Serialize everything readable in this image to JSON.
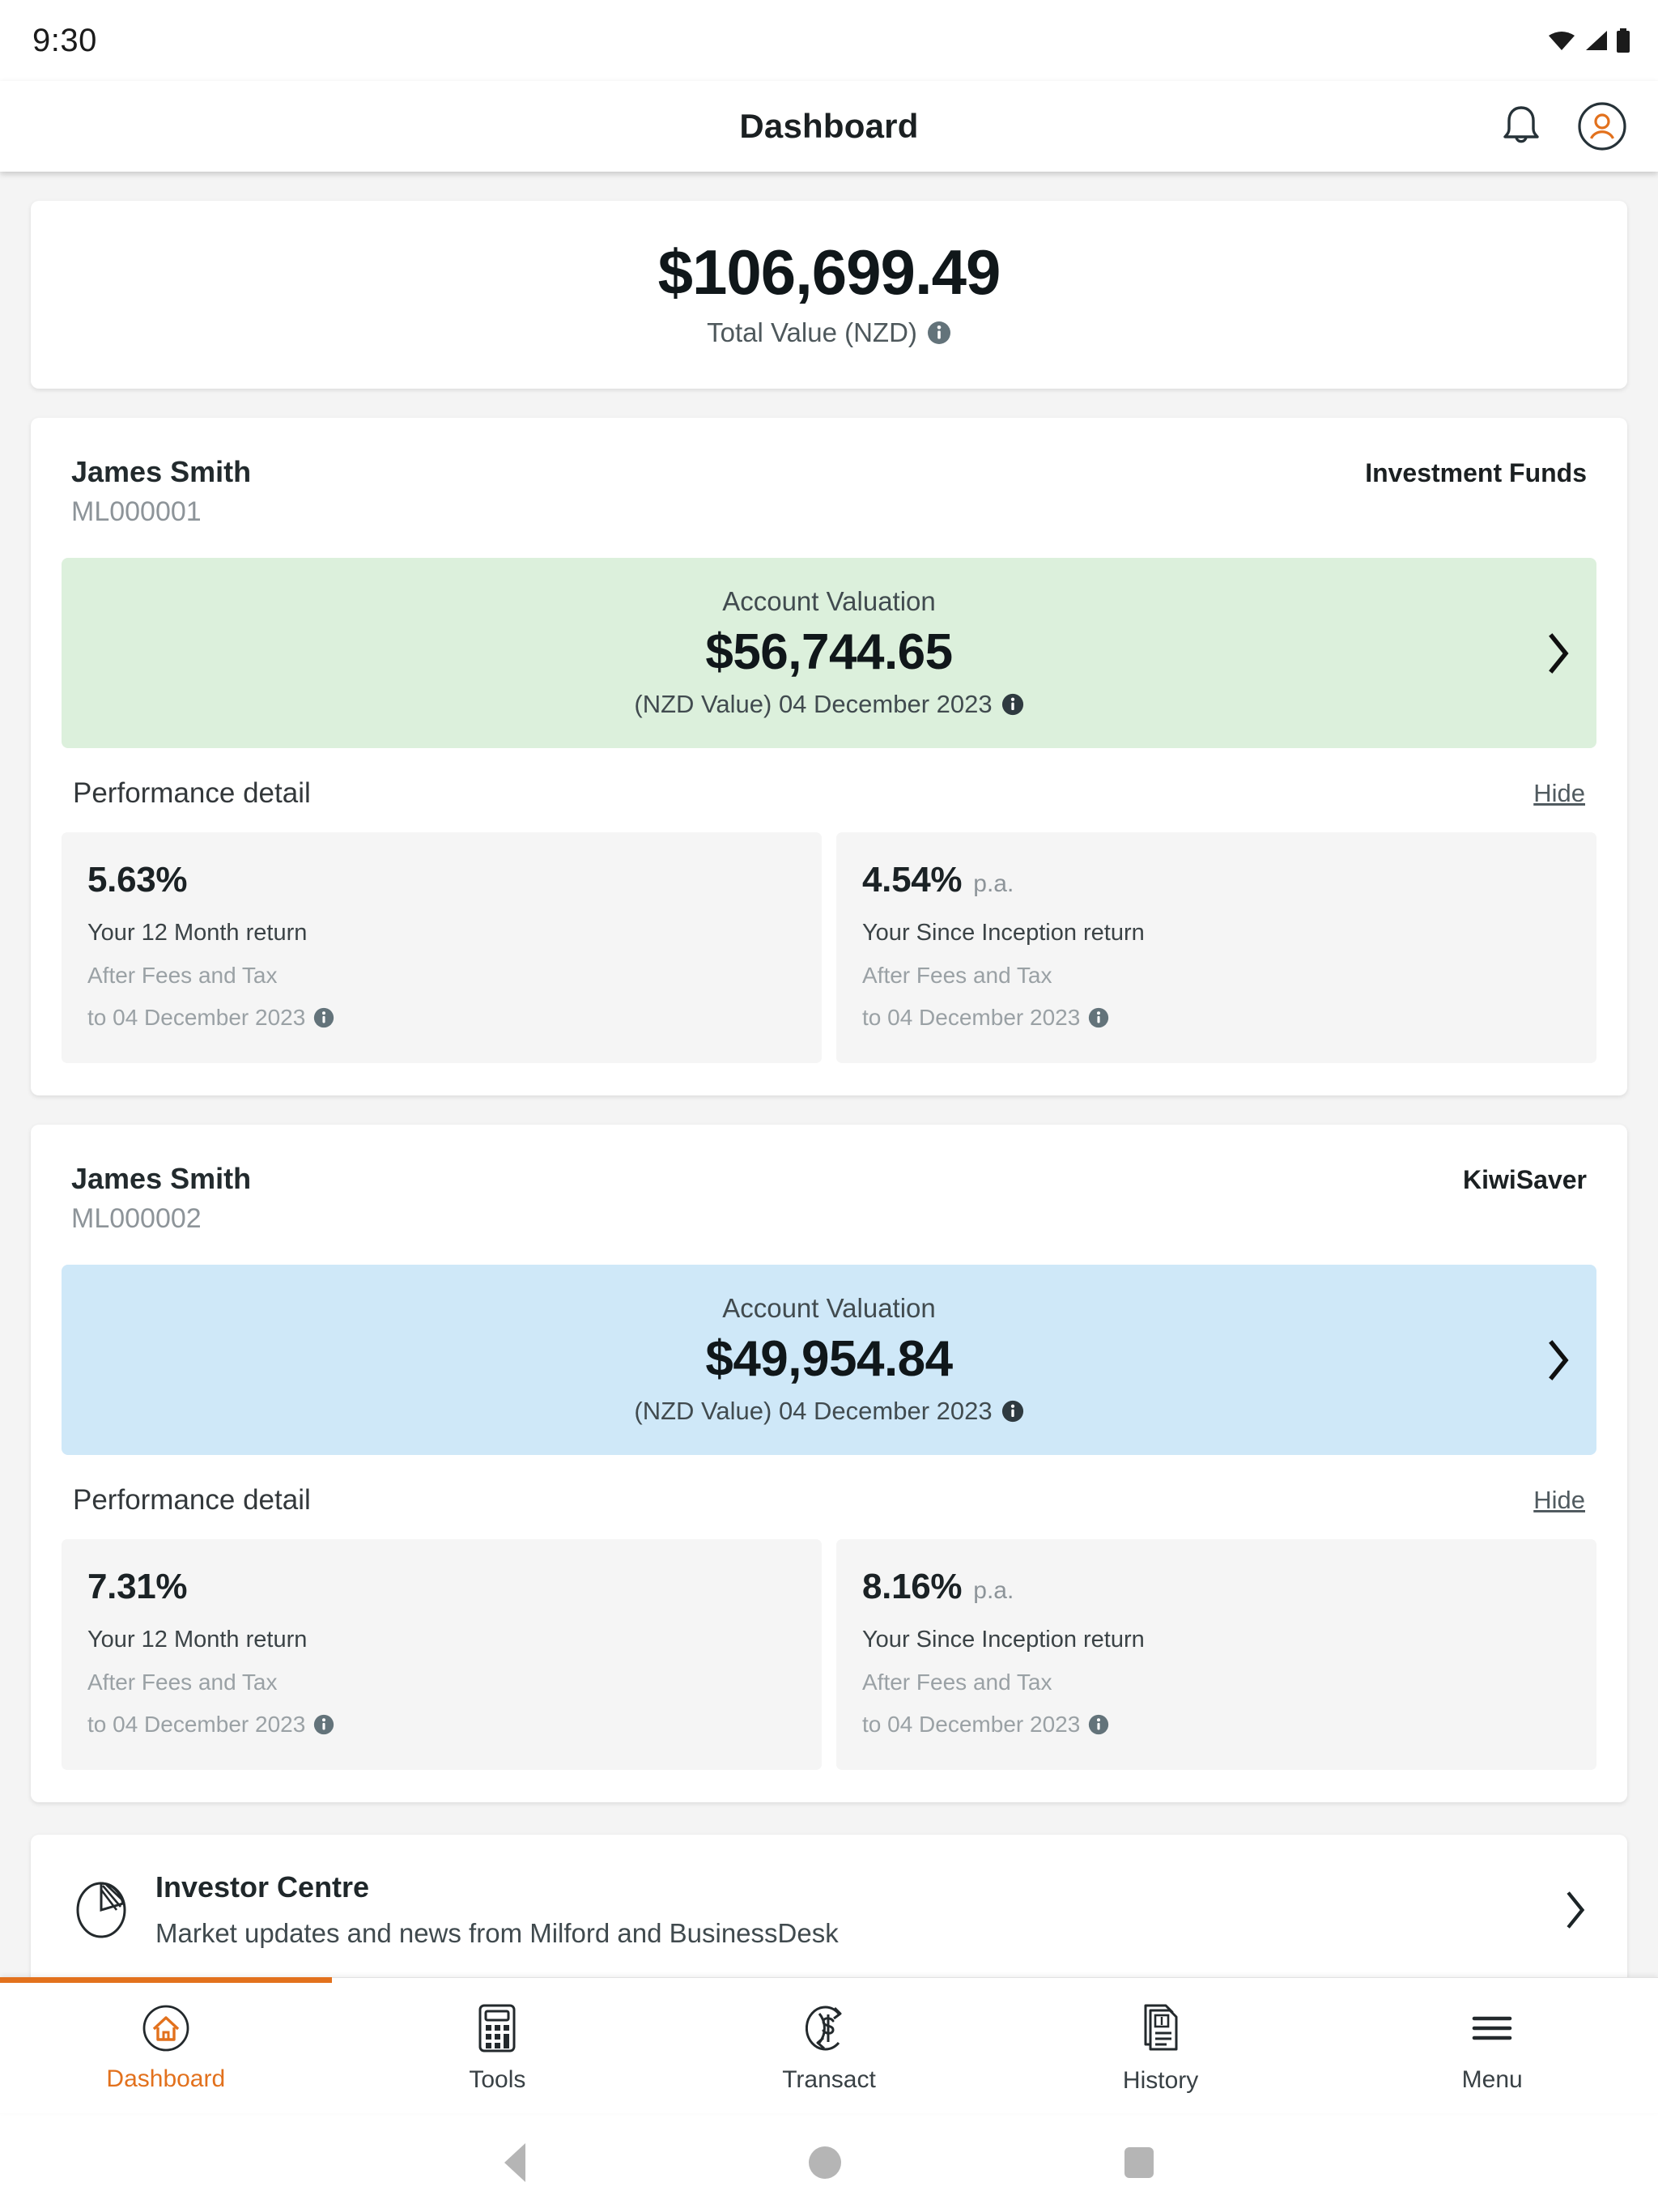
{
  "status_bar": {
    "time": "9:30",
    "icons": [
      "wifi-icon",
      "cellular-signal-icon",
      "battery-icon"
    ]
  },
  "app_bar": {
    "title": "Dashboard",
    "notifications_icon": "bell-icon",
    "profile_icon": "user-avatar-icon"
  },
  "total_card": {
    "amount": "$106,699.49",
    "label": "Total Value (NZD)",
    "info_icon": "info-icon"
  },
  "accounts": [
    {
      "holder_name": "James Smith",
      "account_number": "ML000001",
      "product_type": "Investment Funds",
      "accent_color": "#dcf0dc",
      "valuation": {
        "title": "Account Valuation",
        "amount": "$56,744.65",
        "subtitle": "(NZD Value) 04 December 2023",
        "info_icon": "info-icon",
        "chevron_icon": "chevron-right-icon"
      },
      "performance": {
        "heading": "Performance detail",
        "toggle_label": "Hide",
        "metrics": [
          {
            "value": "5.63%",
            "suffix": "",
            "description": "Your 12 Month return",
            "basis": "After Fees and Tax",
            "as_at": "to 04 December 2023",
            "info_icon": "info-icon"
          },
          {
            "value": "4.54%",
            "suffix": "p.a.",
            "description": "Your Since Inception return",
            "basis": "After Fees and Tax",
            "as_at": "to 04 December 2023",
            "info_icon": "info-icon"
          }
        ]
      }
    },
    {
      "holder_name": "James Smith",
      "account_number": "ML000002",
      "product_type": "KiwiSaver",
      "accent_color": "#cfe8f8",
      "valuation": {
        "title": "Account Valuation",
        "amount": "$49,954.84",
        "subtitle": "(NZD Value) 04 December 2023",
        "info_icon": "info-icon",
        "chevron_icon": "chevron-right-icon"
      },
      "performance": {
        "heading": "Performance detail",
        "toggle_label": "Hide",
        "metrics": [
          {
            "value": "7.31%",
            "suffix": "",
            "description": "Your 12 Month return",
            "basis": "After Fees and Tax",
            "as_at": "to 04 December 2023",
            "info_icon": "info-icon"
          },
          {
            "value": "8.16%",
            "suffix": "p.a.",
            "description": "Your Since Inception return",
            "basis": "After Fees and Tax",
            "as_at": "to 04 December 2023",
            "info_icon": "info-icon"
          }
        ]
      }
    }
  ],
  "investor_centre": {
    "icon": "pie-chart-icon",
    "title": "Investor Centre",
    "subtitle": "Market updates and news from Milford and BusinessDesk",
    "chevron_icon": "chevron-right-icon"
  },
  "tab_bar": {
    "active_color": "#e2711d",
    "inactive_color": "#394145",
    "tabs": [
      {
        "label": "Dashboard",
        "icon": "home-icon",
        "active": true
      },
      {
        "label": "Tools",
        "icon": "calculator-icon",
        "active": false
      },
      {
        "label": "Transact",
        "icon": "dollar-refresh-icon",
        "active": false
      },
      {
        "label": "History",
        "icon": "statement-document-icon",
        "active": false
      },
      {
        "label": "Menu",
        "icon": "hamburger-menu-icon",
        "active": false
      }
    ]
  },
  "android_nav": {
    "back_icon": "triangle-back-icon",
    "home_icon": "circle-home-icon",
    "recents_icon": "square-recents-icon"
  }
}
